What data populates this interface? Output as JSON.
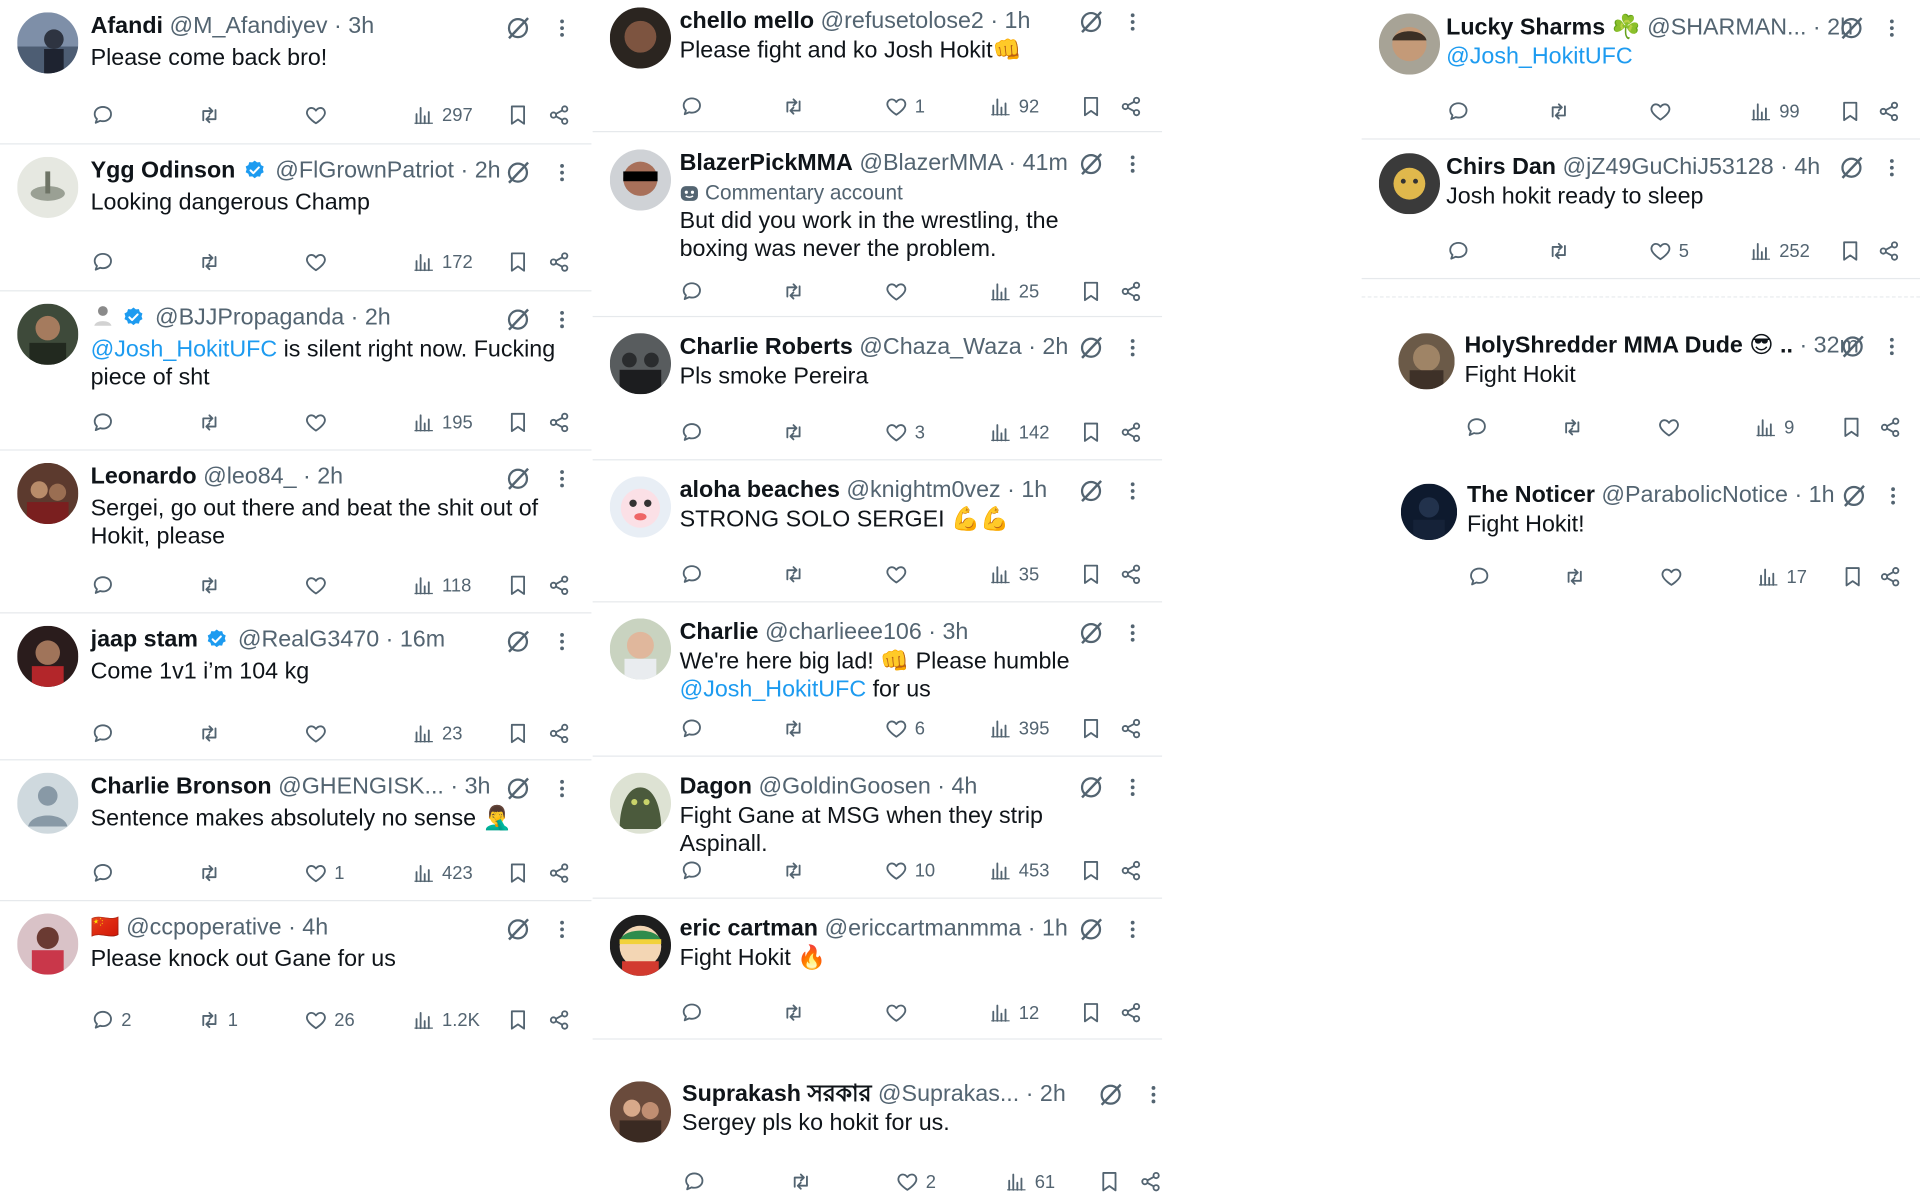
{
  "columns": [
    {
      "posts": [
        {
          "name": "Afandi",
          "handle": "@M_Afandiyev",
          "time": "3h",
          "text": "Please come back bro!",
          "replies": "",
          "reposts": "",
          "likes": "",
          "views": "297"
        },
        {
          "name": "Ygg Odinson",
          "handle": "@FlGrownPatriot",
          "time": "2h",
          "text": "Looking dangerous Champ",
          "replies": "",
          "reposts": "",
          "likes": "",
          "views": "172"
        },
        {
          "name": "",
          "handle": "@BJJPropaganda",
          "time": "2h",
          "mention": "@Josh_HokitUFC",
          "text": " is silent right now. Fucking piece of sht",
          "replies": "",
          "reposts": "",
          "likes": "",
          "views": "195"
        },
        {
          "name": "Leonardo",
          "handle": "@leo84_",
          "time": "2h",
          "text": "Sergei, go out there and beat the shit out of Hokit, please",
          "replies": "",
          "reposts": "",
          "likes": "",
          "views": "118"
        },
        {
          "name": "jaap stam",
          "handle": "@RealG3470",
          "time": "16m",
          "text": "Come 1v1 i’m 104 kg",
          "replies": "",
          "reposts": "",
          "likes": "",
          "views": "23"
        },
        {
          "name": "Charlie Bronson",
          "handle": "@GHENGISK...",
          "time": "3h",
          "text": "Sentence makes absolutely no sense 🤦‍♂️",
          "replies": "",
          "reposts": "",
          "likes": "1",
          "views": "423"
        },
        {
          "name": "",
          "flag": "🇨🇳",
          "handle": "@ccpoperative",
          "time": "4h",
          "text": "Please knock out Gane for us",
          "replies": "2",
          "reposts": "1",
          "likes": "26",
          "views": "1.2K"
        }
      ]
    },
    {
      "posts": [
        {
          "name": "chello mello",
          "handle": "@refusetolose2",
          "time": "1h",
          "text": "Please fight and ko Josh Hokit👊",
          "replies": "",
          "reposts": "",
          "likes": "1",
          "views": "92"
        },
        {
          "name": "BlazerPickMMA",
          "handle": "@BlazerMMA",
          "time": "41m",
          "commentary": "Commentary account",
          "text": "But did you work in the wrestling, the boxing was never the problem.",
          "replies": "",
          "reposts": "",
          "likes": "",
          "views": "25"
        },
        {
          "name": "Charlie Roberts",
          "handle": "@Chaza_Waza",
          "time": "2h",
          "text": "Pls smoke Pereira",
          "replies": "",
          "reposts": "",
          "likes": "3",
          "views": "142"
        },
        {
          "name": "aloha beaches",
          "handle": "@knightm0vez",
          "time": "1h",
          "text": "STRONG SOLO SERGEI 💪💪",
          "replies": "",
          "reposts": "",
          "likes": "",
          "views": "35"
        },
        {
          "name": "Charlie",
          "handle": "@charlieee106",
          "time": "3h",
          "text": "We're here big lad! 👊 Please humble ",
          "mention": "@Josh_HokitUFC",
          "text_after": " for us",
          "replies": "",
          "reposts": "",
          "likes": "6",
          "views": "395"
        },
        {
          "name": "Dagon",
          "handle": "@GoldinGoosen",
          "time": "4h",
          "text": "Fight Gane at MSG when they strip Aspinall.",
          "replies": "",
          "reposts": "",
          "likes": "10",
          "views": "453"
        },
        {
          "name": "eric cartman",
          "handle": "@ericcartmanmma",
          "time": "1h",
          "text": "Fight Hokit 🔥",
          "replies": "",
          "reposts": "",
          "likes": "",
          "views": "12"
        },
        {
          "name": "Suprakash সরকার",
          "handle": "@Suprakas...",
          "time": "2h",
          "text": "Sergey pls ko hokit for us.",
          "replies": "",
          "reposts": "",
          "likes": "2",
          "views": "61"
        }
      ]
    },
    {
      "posts": [
        {
          "name": "Lucky Sharms ☘️",
          "handle": "@SHARMAN...",
          "time": "2h",
          "mention": "@Josh_HokitUFC",
          "text": "",
          "replies": "",
          "reposts": "",
          "likes": "",
          "views": "99"
        },
        {
          "name": "Chirs Dan",
          "handle": "@jZ49GuChiJ53128",
          "time": "4h",
          "text": "Josh hokit ready to sleep",
          "replies": "",
          "reposts": "",
          "likes": "5",
          "views": "252"
        },
        {
          "name": "HolyShredder MMA Dude 😎 ..",
          "handle": "",
          "time": "32m",
          "text": "Fight Hokit",
          "replies": "",
          "reposts": "",
          "likes": "",
          "views": "9"
        },
        {
          "name": "The Noticer",
          "handle": "@ParabolicNotice",
          "time": "1h",
          "text": "Fight Hokit!",
          "replies": "",
          "reposts": "",
          "likes": "",
          "views": "17"
        }
      ]
    }
  ],
  "colors": {
    "accent": "#1d9bf0",
    "muted": "#536471",
    "text": "#0f1419",
    "divider": "#e6e9ec"
  },
  "icons": [
    "reply-icon",
    "repost-icon",
    "like-icon",
    "views-icon",
    "bookmark-icon",
    "share-icon",
    "grok-icon",
    "more-icon",
    "verified-badge-icon"
  ]
}
